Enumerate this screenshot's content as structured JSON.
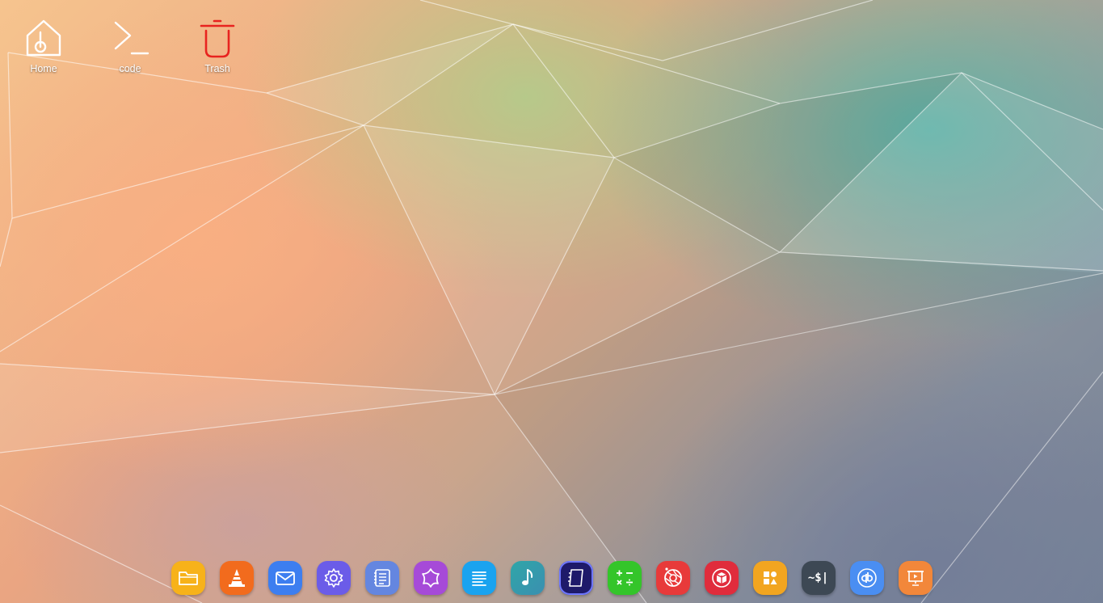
{
  "desktop": {
    "icons": [
      {
        "label": "Home",
        "icon": "home-folder-icon"
      },
      {
        "label": "code",
        "icon": "terminal-prompt-icon"
      },
      {
        "label": "Trash",
        "icon": "trash-icon",
        "color": "#e8231f"
      }
    ]
  },
  "dock": {
    "items": [
      {
        "app": "files",
        "icon": "folder-icon",
        "color": "#f7b21a"
      },
      {
        "app": "vlc",
        "icon": "traffic-cone-icon",
        "color": "#f26b1d"
      },
      {
        "app": "mail",
        "icon": "envelope-icon",
        "color": "#3d7ef0"
      },
      {
        "app": "settings",
        "icon": "gear-icon",
        "color": "#6b5ce8"
      },
      {
        "app": "text-editor",
        "icon": "notes-icon",
        "color": "#6486e0"
      },
      {
        "app": "themes",
        "icon": "star-badge-icon",
        "color": "#a64ad8"
      },
      {
        "app": "document-viewer",
        "icon": "document-lines-icon",
        "color": "#1aa3ef"
      },
      {
        "app": "music",
        "icon": "music-note-icon",
        "color": "#2fa6a8"
      },
      {
        "app": "notebook",
        "icon": "notebook-icon",
        "color": "#1e1a6a"
      },
      {
        "app": "calculator",
        "icon": "calculator-icon",
        "color": "#34c52a"
      },
      {
        "app": "camera",
        "icon": "aperture-icon",
        "color": "#e83a3a"
      },
      {
        "app": "software-center",
        "icon": "package-box-icon",
        "color": "#e02c3c"
      },
      {
        "app": "app-launcher",
        "icon": "shapes-grid-icon",
        "color": "#f2a520"
      },
      {
        "app": "terminal",
        "icon": "terminal-dollar-icon",
        "label": "~$|",
        "color": "#3d4854"
      },
      {
        "app": "qbittorrent",
        "icon": "qb-logo-icon",
        "color": "#4a8ef2"
      },
      {
        "app": "presentation",
        "icon": "presentation-screen-icon",
        "color": "#f2873a"
      }
    ]
  }
}
